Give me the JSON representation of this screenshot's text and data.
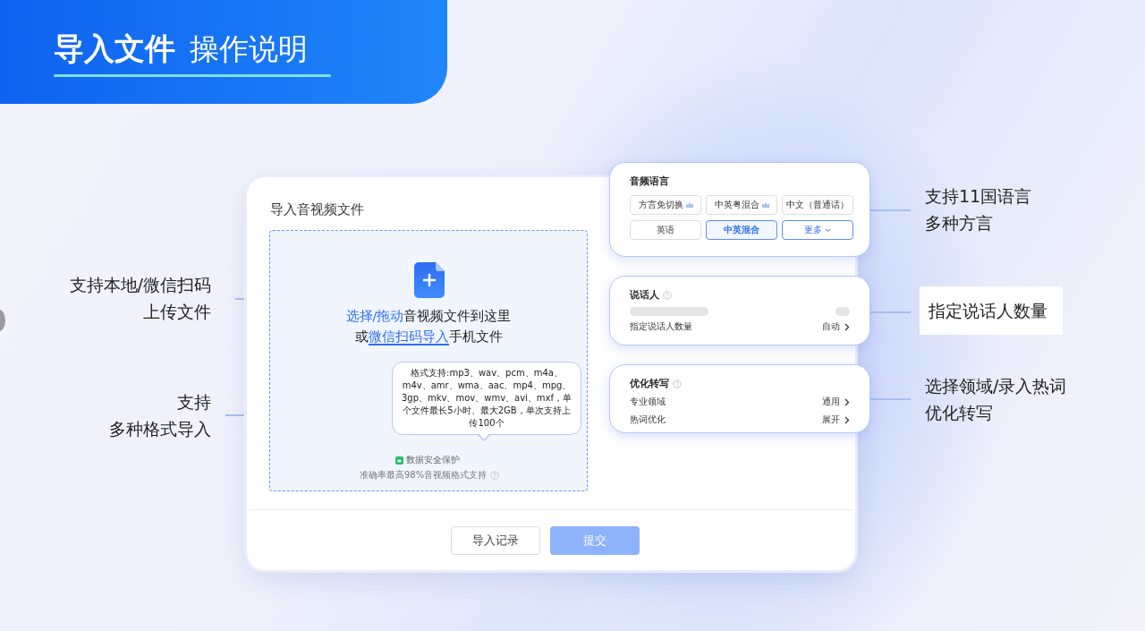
{
  "header": {
    "title": "导入文件",
    "subtitle": "操作说明"
  },
  "left_notes": [
    {
      "lines": [
        "支持本地/微信扫码",
        "上传文件"
      ]
    },
    {
      "lines": [
        "支持",
        "多种格式导入"
      ]
    }
  ],
  "right_notes": [
    {
      "lines": [
        "支持11国语言",
        "多种方言"
      ],
      "boxed": false
    },
    {
      "lines": [
        "指定说话人数量"
      ],
      "boxed": true
    },
    {
      "lines": [
        "选择领域/录入热词",
        "优化转写"
      ],
      "boxed": false
    }
  ],
  "import_panel": {
    "title": "导入音视频文件",
    "upload_lines": [
      [
        {
          "kind": "link",
          "text": "选择/拖动"
        },
        {
          "kind": "plain",
          "text": "音视频文件到这里"
        }
      ],
      [
        {
          "kind": "plain",
          "text": "或"
        },
        {
          "kind": "underlined",
          "text": "微信扫码导入"
        },
        {
          "kind": "plain",
          "text": "手机文件"
        }
      ]
    ],
    "tooltip": "格式支持:mp3、wav、pcm、m4a、m4v、amr、wma、aac、mp4、mpg、3gp、mkv、mov、wmv、avi、mxf，单个文件最长5小时、最大2GB，单次支持上传100个",
    "security": "数据安全保护",
    "accuracy": "准确率最高98%音视频格式支持",
    "buttons": [
      {
        "label": "导入记录",
        "kind": "secondary",
        "disabled": false
      },
      {
        "label": "提交",
        "kind": "primary",
        "disabled": true
      }
    ]
  },
  "language_card": {
    "title": "音频语言",
    "options": [
      {
        "label": "方言免切换",
        "vip": true,
        "selected": false
      },
      {
        "label": "中英粤混合",
        "vip": true,
        "selected": false
      },
      {
        "label": "中文（普通话）",
        "vip": false,
        "selected": false
      },
      {
        "label": "英语",
        "vip": false,
        "selected": false
      },
      {
        "label": "中英混合",
        "vip": false,
        "selected": true
      },
      {
        "label": "更多",
        "vip": false,
        "selected": false,
        "kind": "dropdown"
      }
    ]
  },
  "speaker_card": {
    "title": "说话人",
    "rows": [
      {
        "label": "指定说话人数量",
        "value": "自动"
      }
    ]
  },
  "optimize_card": {
    "title": "优化转写",
    "rows": [
      {
        "label": "专业领域",
        "value": "通用"
      },
      {
        "label": "热词优化",
        "value": "展开"
      }
    ]
  }
}
